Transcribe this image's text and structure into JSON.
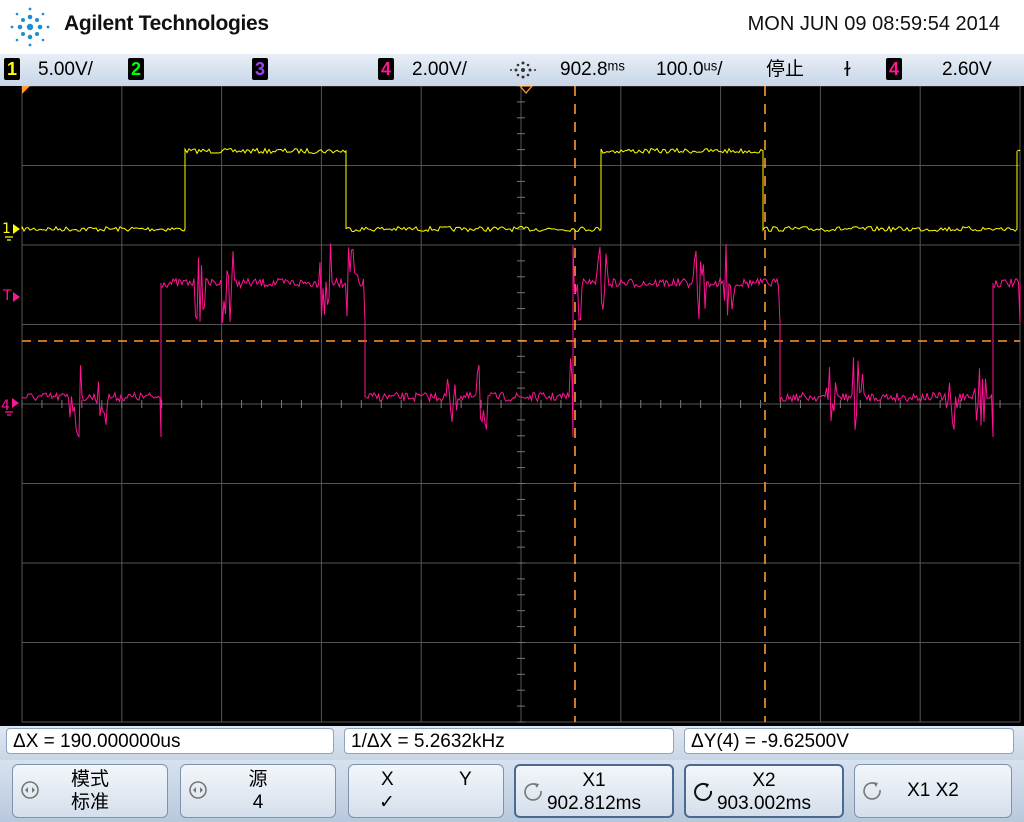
{
  "header": {
    "brand": "Agilent Technologies",
    "datetime": "MON JUN 09 08:59:54 2014"
  },
  "status": {
    "ch1_num": "1",
    "ch1_scale": "5.00V/",
    "ch2_num": "2",
    "ch3_num": "3",
    "ch4_num": "4",
    "ch4_scale": "2.00V/",
    "time_delay": "902.8ᵐˢ",
    "time_scale": "100.0ᵘˢ/",
    "run_state": "停止",
    "trigger_slope": "ɫ",
    "trigger_ch": "4",
    "trigger_level": "2.60V"
  },
  "markers": {
    "ch1": "1",
    "trigger": "T",
    "ch4": "4"
  },
  "measurements": {
    "delta_x": "ΔX = 190.000000us",
    "inv_delta_x": "1/ΔX = 5.2632kHz",
    "delta_y": "ΔY(4) = -9.62500V"
  },
  "softkeys": [
    {
      "line1": "模式",
      "line2": "标准"
    },
    {
      "line1": "源",
      "line2": "4"
    },
    {
      "line1": "X",
      "line1b": "Y",
      "line2": "✓"
    },
    {
      "line1": "X1",
      "line2": "902.812ms"
    },
    {
      "line1": "X2",
      "line2": "903.002ms"
    },
    {
      "line1": "X1 X2",
      "line2": ""
    }
  ],
  "colors": {
    "ch1": "#ffff00",
    "ch2": "#00ff00",
    "ch3": "#a040ff",
    "ch4": "#ff1493",
    "cursor": "#ff9933",
    "grid": "#555555"
  }
}
